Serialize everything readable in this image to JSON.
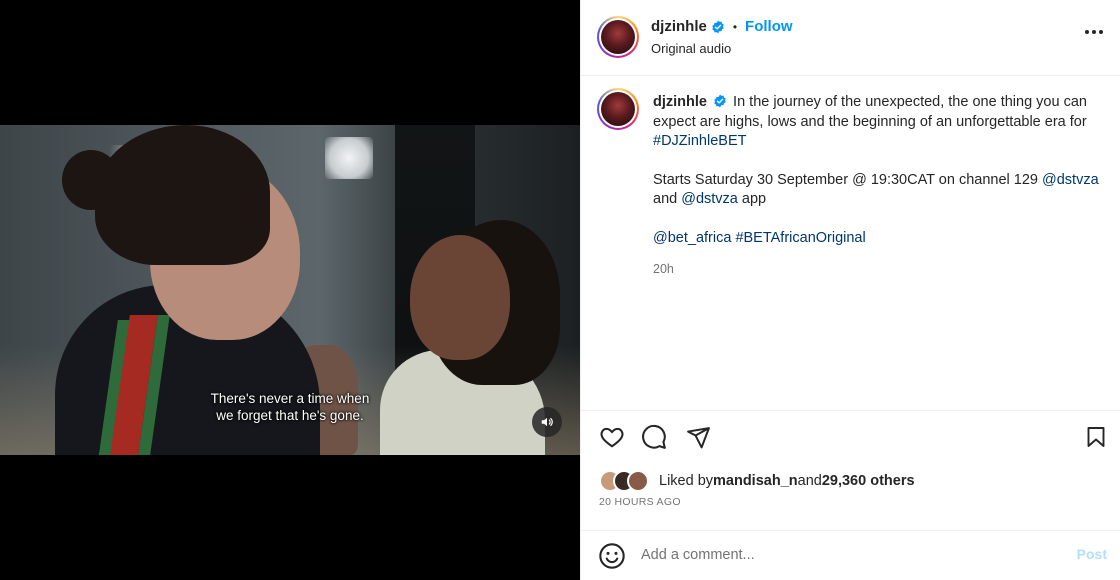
{
  "media": {
    "subtitle_line1": "There's never a time when",
    "subtitle_line2": "we forget that he's gone.",
    "sound_icon": "speaker-icon"
  },
  "header": {
    "username": "djzinhle",
    "separator": "•",
    "follow_label": "Follow",
    "audio_label": "Original audio",
    "verified_color": "#0095f6"
  },
  "caption": {
    "username": "djzinhle",
    "line1": "In the journey of the unexpected, the one thing you can expect are highs, lows and the beginning of an unforgettable era for ",
    "hashtag1": "#DJZinhleBET",
    "para2_text": "Starts Saturday 30 September @ 19:30CAT on channel 129 ",
    "mention1": "@dstvza",
    "para2_and": " and ",
    "mention2": "@dstvza",
    "para2_end": " app",
    "mention3": "@bet_africa",
    "space": " ",
    "hashtag2": "#BETAfricanOriginal",
    "time": "20h"
  },
  "actions": {
    "like_icon": "heart-icon",
    "comment_icon": "comment-icon",
    "share_icon": "share-icon",
    "save_icon": "bookmark-icon"
  },
  "likes": {
    "prefix": "Liked by ",
    "user": "mandisah_n",
    "middle": " and ",
    "count": "29,360 others"
  },
  "posted_ago": "20 HOURS AGO",
  "comment": {
    "placeholder": "Add a comment...",
    "post_label": "Post"
  },
  "colors": {
    "link": "#00376b",
    "follow": "#0095f6",
    "post_disabled": "#b2dffc"
  }
}
